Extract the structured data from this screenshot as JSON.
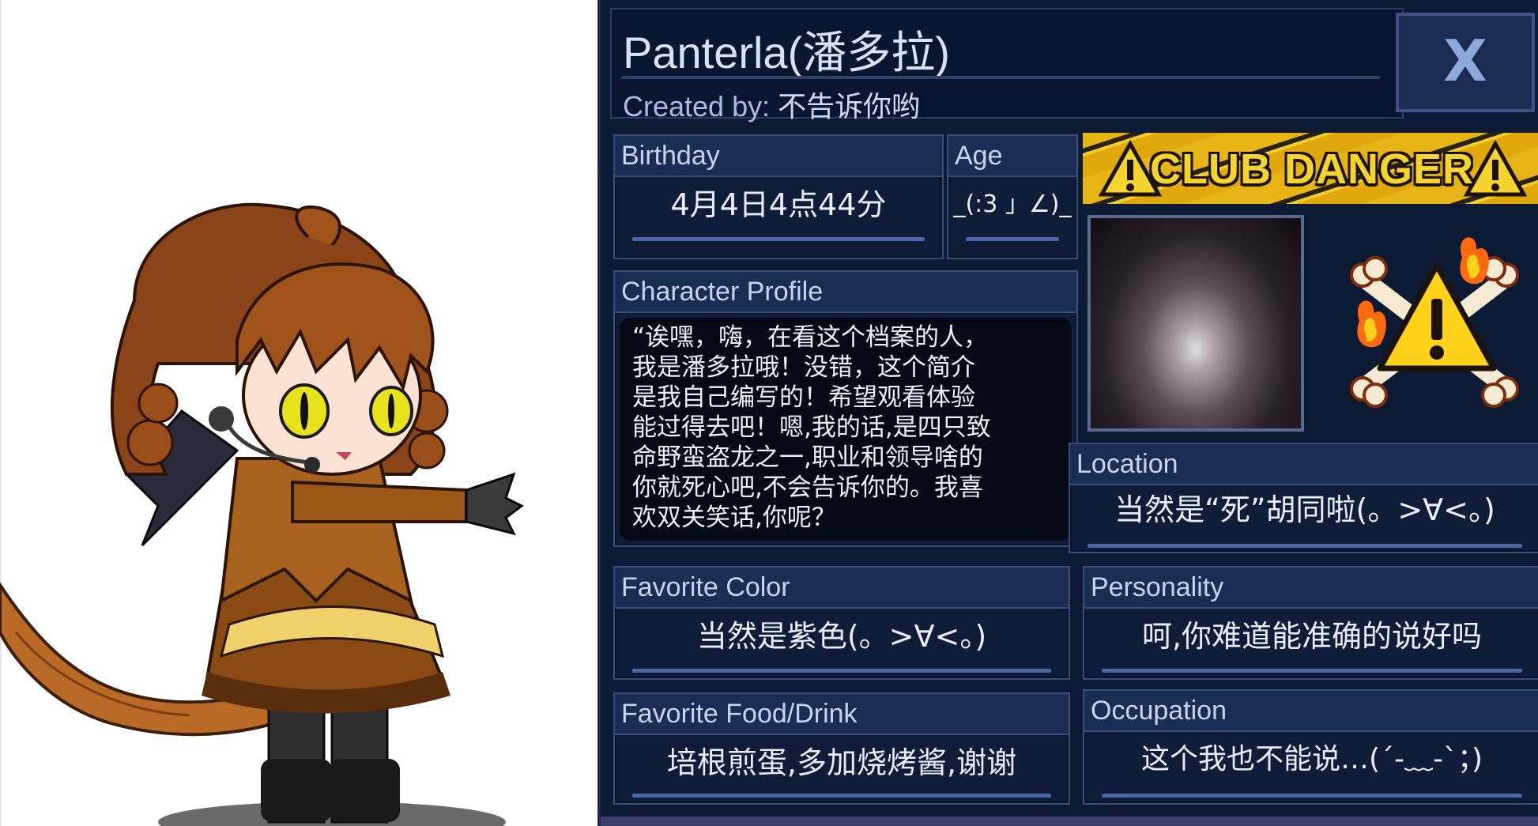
{
  "character": {
    "name": "Panterla(潘多拉)",
    "created_by_label": "Created by:",
    "created_by": "不告诉你哟"
  },
  "close_button": {
    "label": "X",
    "icon": "close-icon"
  },
  "fields": {
    "birthday": {
      "label": "Birthday",
      "value": "4月4日4点44分"
    },
    "age": {
      "label": "Age",
      "value": "_(:3 」∠)_"
    },
    "profile": {
      "label": "Character Profile",
      "text": "“诶嘿，嗨，在看这个档案的人，\n我是潘多拉哦！没错，这个简介\n是我自己编写的！希望观看体验\n能过得去吧！嗯,我的话,是四只致\n命野蛮盗龙之一,职业和领导啥的\n你就死心吧,不会告诉你的。我喜\n欢双关笑话,你呢？"
    },
    "location": {
      "label": "Location",
      "value": "当然是“死”胡同啦(。>∀<。)"
    },
    "favorite_color": {
      "label": "Favorite Color",
      "value": "当然是紫色(。>∀<。)"
    },
    "personality": {
      "label": "Personality",
      "value": "呵,你难道能准确的说好吗"
    },
    "favorite_food": {
      "label": "Favorite Food/Drink",
      "value": "培根煎蛋,多加烧烤酱,谢谢"
    },
    "occupation": {
      "label": "Occupation",
      "value": "这个我也不能说…(´-﹏-`；)"
    }
  },
  "club": {
    "name": "CLUB DANGER",
    "banner_icon": "warning-icon",
    "emblem_icon": "danger-warning-crossbones-icon"
  },
  "colors": {
    "panel_bg": "#0d1a33",
    "header_bg": "#1a2d52",
    "border": "#3a4e78",
    "banner_yellow": "#f2cc2c"
  }
}
